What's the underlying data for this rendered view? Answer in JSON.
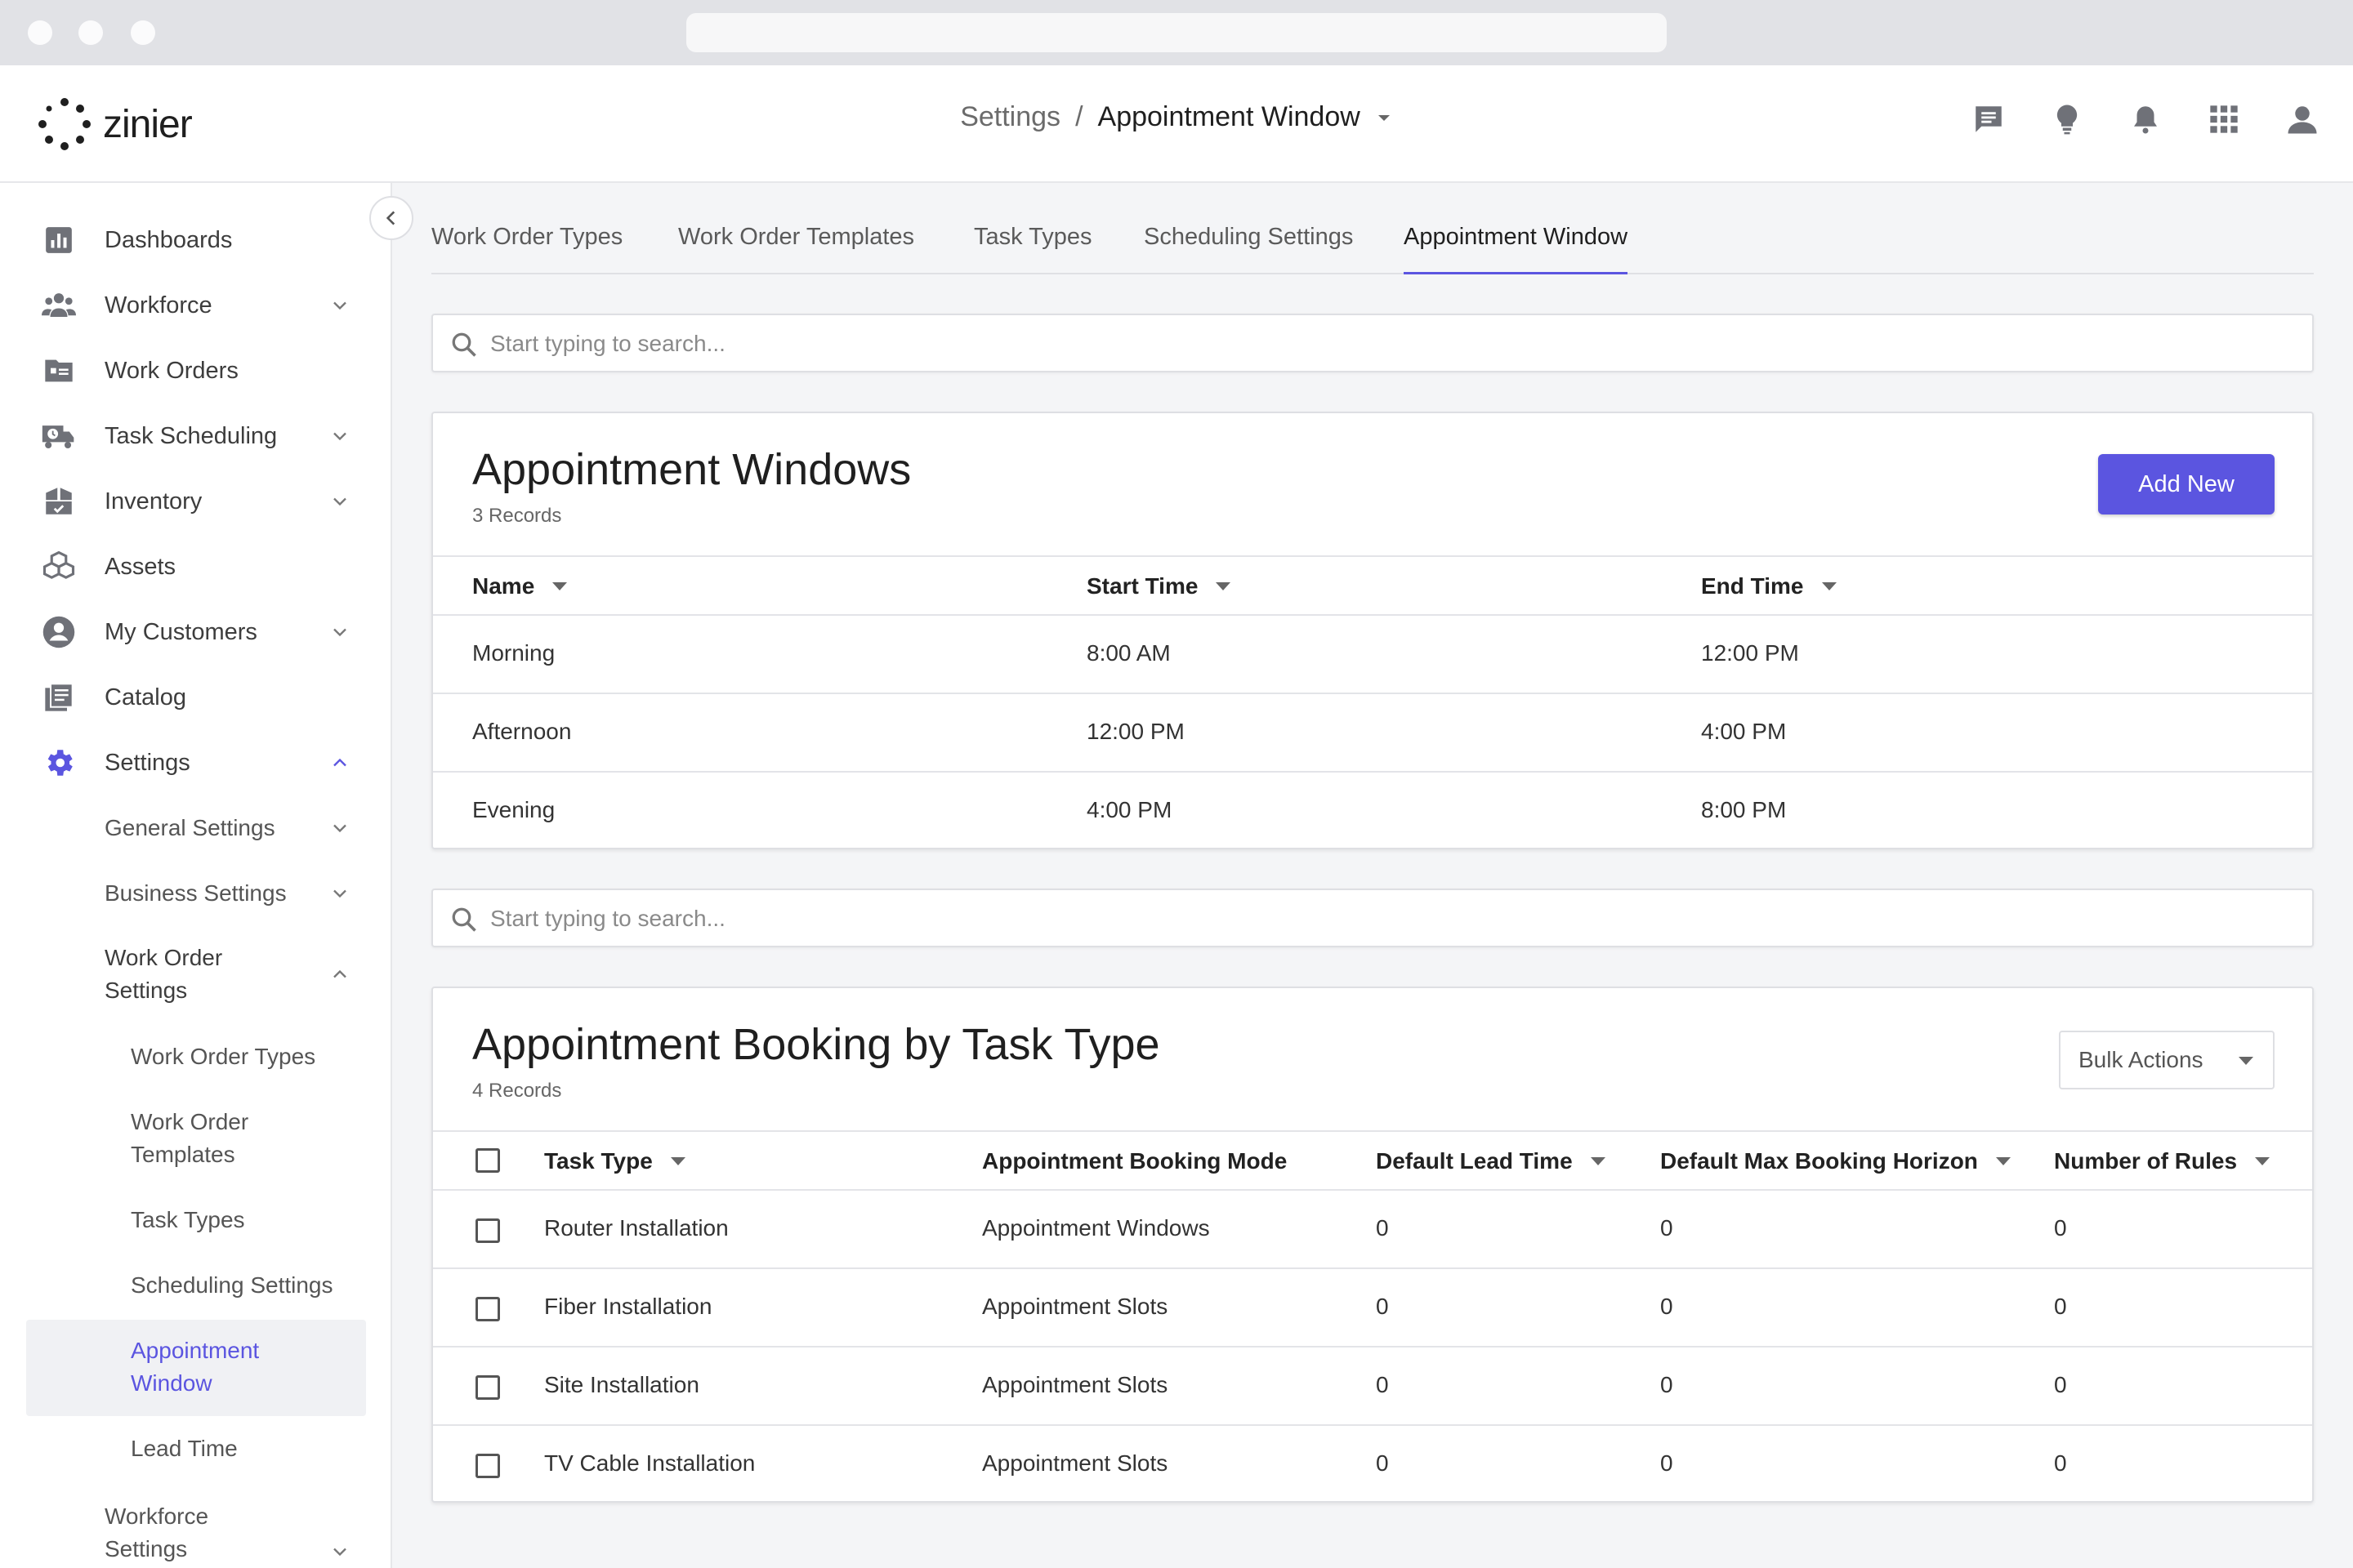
{
  "header": {
    "logo_text": "zinier",
    "breadcrumb_parent": "Settings",
    "breadcrumb_separator": "/",
    "breadcrumb_current": "Appointment Window",
    "icons": [
      "chat-icon",
      "lightbulb-icon",
      "bell-icon",
      "apps-grid-icon",
      "user-icon"
    ]
  },
  "sidebar": {
    "items": [
      {
        "label": "Dashboards",
        "icon": "bar-chart-icon"
      },
      {
        "label": "Workforce",
        "icon": "people-icon"
      },
      {
        "label": "Work Orders",
        "icon": "work-orders-icon"
      },
      {
        "label": "Task Scheduling",
        "icon": "truck-icon"
      },
      {
        "label": "Inventory",
        "icon": "inventory-icon"
      },
      {
        "label": "Assets",
        "icon": "assets-icon"
      },
      {
        "label": "My Customers",
        "icon": "customer-icon"
      },
      {
        "label": "Catalog",
        "icon": "catalog-icon"
      },
      {
        "label": "Settings",
        "icon": "gear-icon"
      }
    ],
    "settings_sub": [
      {
        "label": "General Settings"
      },
      {
        "label": "Business Settings"
      },
      {
        "label": "Work Order Settings"
      }
    ],
    "work_order_sub": [
      {
        "label": "Work Order Types"
      },
      {
        "label": "Work Order Templates"
      },
      {
        "label": "Task Types"
      },
      {
        "label": "Scheduling Settings"
      },
      {
        "label": "Appointment Window"
      },
      {
        "label": "Lead Time"
      }
    ],
    "workforce_settings": "Workforce Settings",
    "active_color": "#5b55e0"
  },
  "tabs": [
    {
      "label": "Work Order Types"
    },
    {
      "label": "Work Order Templates"
    },
    {
      "label": "Task Types"
    },
    {
      "label": "Scheduling Settings"
    },
    {
      "label": "Appointment Window"
    }
  ],
  "search1": {
    "placeholder": "Start typing to search..."
  },
  "search2": {
    "placeholder": "Start typing to search..."
  },
  "windows": {
    "title": "Appointment Windows",
    "records": "3 Records",
    "add_label": "Add New",
    "columns": [
      "Name",
      "Start Time",
      "End Time"
    ],
    "rows": [
      [
        "Morning",
        "8:00 AM",
        "12:00 PM"
      ],
      [
        "Afternoon",
        "12:00 PM",
        "4:00 PM"
      ],
      [
        "Evening",
        "4:00 PM",
        "8:00 PM"
      ]
    ]
  },
  "booking": {
    "title": "Appointment Booking by Task Type",
    "records": "4 Records",
    "bulk_label": "Bulk Actions",
    "columns": [
      "Task Type",
      "Appointment Booking Mode",
      "Default Lead Time",
      "Default Max Booking Horizon",
      "Number of Rules"
    ],
    "rows": [
      [
        "Router Installation",
        "Appointment Windows",
        "0",
        "0",
        "0"
      ],
      [
        "Fiber Installation",
        "Appointment Slots",
        "0",
        "0",
        "0"
      ],
      [
        "Site Installation",
        "Appointment Slots",
        "0",
        "0",
        "0"
      ],
      [
        "TV Cable Installation",
        "Appointment Slots",
        "0",
        "0",
        "0"
      ]
    ]
  },
  "colors": {
    "accent": "#5b55e0",
    "icon_gray": "#6f7178"
  }
}
